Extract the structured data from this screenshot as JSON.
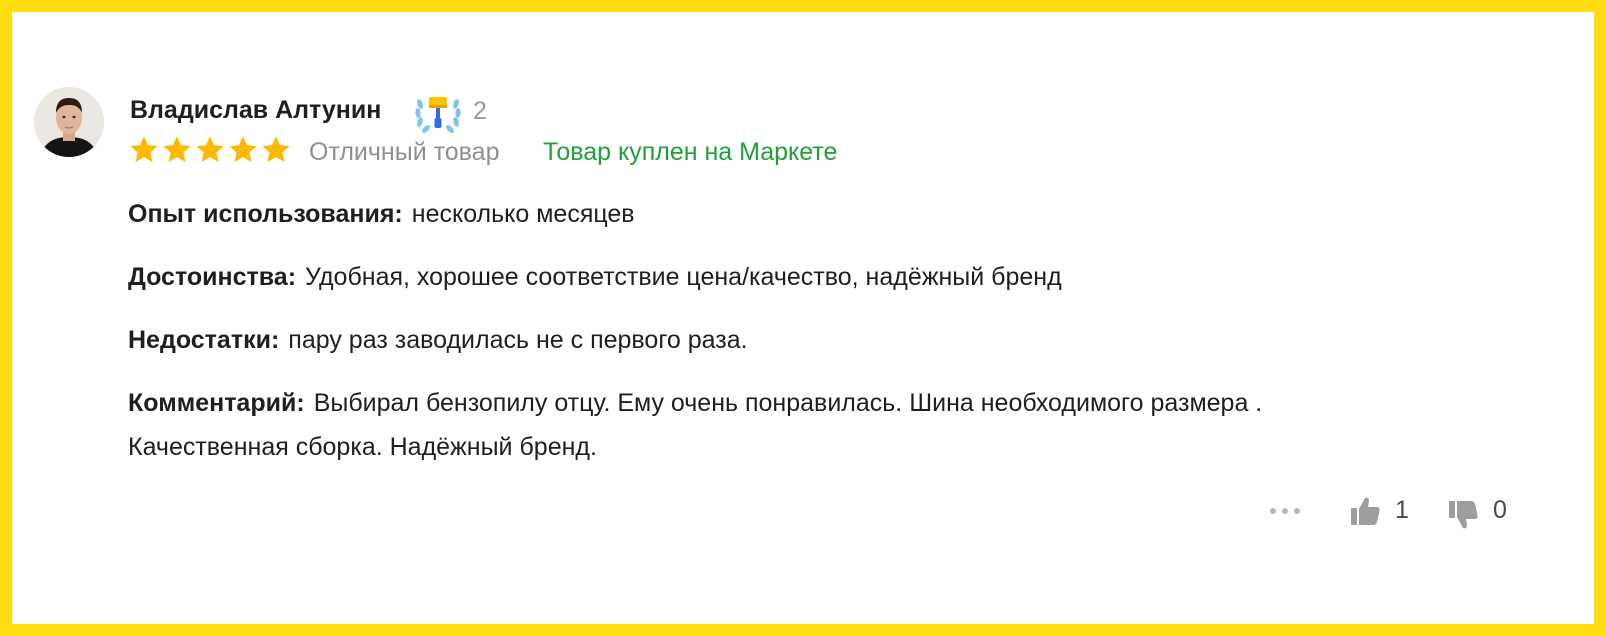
{
  "review": {
    "author": {
      "name": "Владислав Алтунин",
      "avatar": "user-photo",
      "badge": {
        "icon": "paint-roller-laurel-badge-icon",
        "count": "2"
      }
    },
    "rating": {
      "stars": 5,
      "max": 5,
      "text": "Отличный товар",
      "star_color": "#ffb800"
    },
    "purchase_label": "Товар куплен на Маркете",
    "purchase_color": "#21a038",
    "fields": {
      "experience": {
        "label": "Опыт использования:",
        "value": "несколько месяцев"
      },
      "pros": {
        "label": "Достоинства:",
        "value": "Удобная, хорошее соответствие цена/качество, надёжный бренд"
      },
      "cons": {
        "label": "Недостатки:",
        "value": "пару раз заводилась не с первого раза."
      },
      "comment": {
        "label": "Комментарий:",
        "value": "Выбирал бензопилу отцу. Ему очень понравилась. Шина необходимого размера . Качественная сборка. Надёжный бренд."
      }
    },
    "actions": {
      "more_icon": "more-dots-icon",
      "like_icon": "thumb-up-icon",
      "likes": "1",
      "dislike_icon": "thumb-down-icon",
      "dislikes": "0"
    }
  },
  "frame_color": "#ffdb0f"
}
